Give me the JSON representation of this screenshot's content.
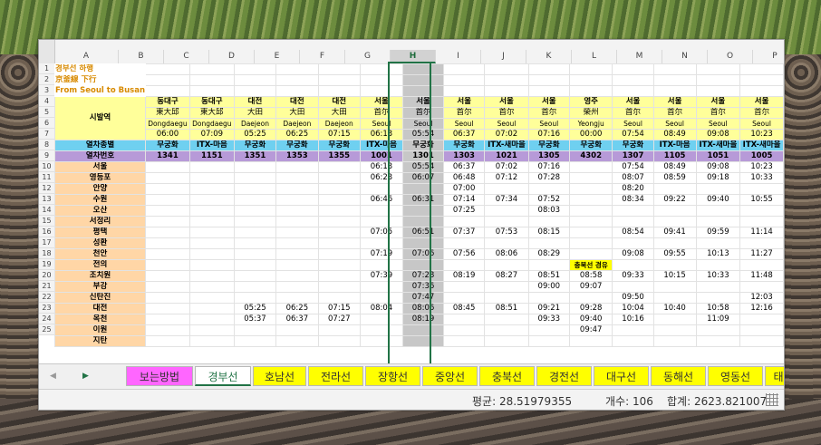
{
  "columns": [
    "A",
    "B",
    "C",
    "D",
    "E",
    "F",
    "G",
    "H",
    "I",
    "J",
    "K",
    "L",
    "M",
    "N",
    "O",
    "P"
  ],
  "selected_column": "H",
  "row_numbers": [
    "1",
    "2",
    "3",
    "4",
    "5",
    "6",
    "7",
    "8",
    "9",
    "10",
    "11",
    "12",
    "13",
    "14",
    "15",
    "16",
    "17",
    "18",
    "19",
    "20",
    "21",
    "22",
    "23",
    "24",
    "25"
  ],
  "titles": [
    "경부선 하행",
    "京釜線 下行",
    "From Seoul to Busan"
  ],
  "header_label": "시발역",
  "origin": {
    "names": [
      "동대구",
      "동대구",
      "대전",
      "대전",
      "대전",
      "서울",
      "서울",
      "서울",
      "서울",
      "서울",
      "영주",
      "서울",
      "서울",
      "서울",
      "서울"
    ],
    "hanja": [
      "東大邱",
      "東大邱",
      "大田",
      "大田",
      "大田",
      "首尔",
      "首尔",
      "首尔",
      "首尔",
      "首尔",
      "榮州",
      "首尔",
      "首尔",
      "首尔",
      "首尔"
    ],
    "english": [
      "Dongdaegu",
      "Dongdaegu",
      "Daejeon",
      "Daejeon",
      "Daejeon",
      "Seoul",
      "Seoul",
      "Seoul",
      "Seoul",
      "Seoul",
      "Yeongju",
      "Seoul",
      "Seoul",
      "Seoul",
      "Seoul"
    ],
    "departure": [
      "06:00",
      "07:09",
      "05:25",
      "06:25",
      "07:15",
      "06:13",
      "05:54",
      "06:37",
      "07:02",
      "07:16",
      "00:00",
      "07:54",
      "08:49",
      "09:08",
      "10:23"
    ]
  },
  "type_label": "열차종별",
  "types": [
    "무궁화",
    "ITX-마음",
    "무궁화",
    "무궁화",
    "무궁화",
    "ITX-마음",
    "무궁화",
    "무궁화",
    "ITX-새마을",
    "무궁화",
    "무궁화",
    "무궁화",
    "ITX-마음",
    "ITX-새마을",
    "ITX-새마을"
  ],
  "number_label": "열차번호",
  "numbers": [
    "1341",
    "1151",
    "1351",
    "1353",
    "1355",
    "1001",
    "1301",
    "1303",
    "1021",
    "1305",
    "4302",
    "1307",
    "1105",
    "1051",
    "1005"
  ],
  "rows": [
    {
      "station": "서울",
      "cells": [
        "",
        "",
        "",
        "",
        "",
        "06:13",
        "05:54",
        "06:37",
        "07:02",
        "07:16",
        "",
        "07:54",
        "08:49",
        "09:08",
        "10:23"
      ]
    },
    {
      "station": "영등포",
      "cells": [
        "",
        "",
        "",
        "",
        "",
        "06:23",
        "06:07",
        "06:48",
        "07:12",
        "07:28",
        "",
        "08:07",
        "08:59",
        "09:18",
        "10:33"
      ]
    },
    {
      "station": "안양",
      "cells": [
        "",
        "",
        "",
        "",
        "",
        "",
        "",
        "07:00",
        "",
        "",
        "",
        "08:20",
        "",
        "",
        ""
      ]
    },
    {
      "station": "수원",
      "cells": [
        "",
        "",
        "",
        "",
        "",
        "06:46",
        "06:31",
        "07:14",
        "07:34",
        "07:52",
        "",
        "08:34",
        "09:22",
        "09:40",
        "10:55"
      ]
    },
    {
      "station": "오산",
      "cells": [
        "",
        "",
        "",
        "",
        "",
        "",
        "",
        "07:25",
        "",
        "08:03",
        "",
        "",
        "",
        "",
        ""
      ]
    },
    {
      "station": "서정리",
      "cells": [
        "",
        "",
        "",
        "",
        "",
        "",
        "",
        "",
        "",
        "",
        "",
        "",
        "",
        "",
        ""
      ]
    },
    {
      "station": "평택",
      "cells": [
        "",
        "",
        "",
        "",
        "",
        "07:05",
        "06:51",
        "07:37",
        "07:53",
        "08:15",
        "",
        "08:54",
        "09:41",
        "09:59",
        "11:14"
      ]
    },
    {
      "station": "성환",
      "cells": [
        "",
        "",
        "",
        "",
        "",
        "",
        "",
        "",
        "",
        "",
        "",
        "",
        "",
        "",
        ""
      ]
    },
    {
      "station": "천안",
      "cells": [
        "",
        "",
        "",
        "",
        "",
        "07:19",
        "07:06",
        "07:56",
        "08:06",
        "08:29",
        "",
        "09:08",
        "09:55",
        "10:13",
        "11:27"
      ]
    },
    {
      "station": "전의",
      "cells": [
        "",
        "",
        "",
        "",
        "",
        "",
        "",
        "",
        "",
        "",
        "충북선 경유",
        "",
        "",
        "",
        ""
      ]
    },
    {
      "station": "조치원",
      "cells": [
        "",
        "",
        "",
        "",
        "",
        "07:39",
        "07:28",
        "08:19",
        "08:27",
        "08:51",
        "08:58",
        "09:33",
        "10:15",
        "10:33",
        "11:48"
      ]
    },
    {
      "station": "부강",
      "cells": [
        "",
        "",
        "",
        "",
        "",
        "",
        "07:36",
        "",
        "",
        "09:00",
        "09:07",
        "",
        "",
        "",
        ""
      ]
    },
    {
      "station": "신탄진",
      "cells": [
        "",
        "",
        "",
        "",
        "",
        "",
        "07:47",
        "",
        "",
        "",
        "",
        "09:50",
        "",
        "",
        "12:03"
      ]
    },
    {
      "station": "대전",
      "cells": [
        "",
        "",
        "05:25",
        "06:25",
        "07:15",
        "08:04",
        "08:06",
        "08:45",
        "08:51",
        "09:21",
        "09:28",
        "10:04",
        "10:40",
        "10:58",
        "12:16"
      ]
    },
    {
      "station": "옥천",
      "cells": [
        "",
        "",
        "05:37",
        "06:37",
        "07:27",
        "",
        "08:19",
        "",
        "",
        "09:33",
        "09:40",
        "10:16",
        "",
        "11:09",
        ""
      ]
    },
    {
      "station": "이원",
      "cells": [
        "",
        "",
        "",
        "",
        "",
        "",
        "",
        "",
        "",
        "",
        "09:47",
        "",
        "",
        "",
        ""
      ]
    },
    {
      "station": "지탄",
      "cells": [
        "",
        "",
        "",
        "",
        "",
        "",
        "",
        "",
        "",
        "",
        "",
        "",
        "",
        "",
        ""
      ]
    }
  ],
  "tabs": [
    "보는방법",
    "경부선",
    "호남선",
    "전라선",
    "장항선",
    "중앙선",
    "충북선",
    "경전선",
    "대구선",
    "동해선",
    "영동선",
    "태"
  ],
  "active_tab": "경부선",
  "status": {
    "average": "평균: 28.51979355",
    "count": "개수: 106",
    "sum": "합계: 2623.821007"
  }
}
